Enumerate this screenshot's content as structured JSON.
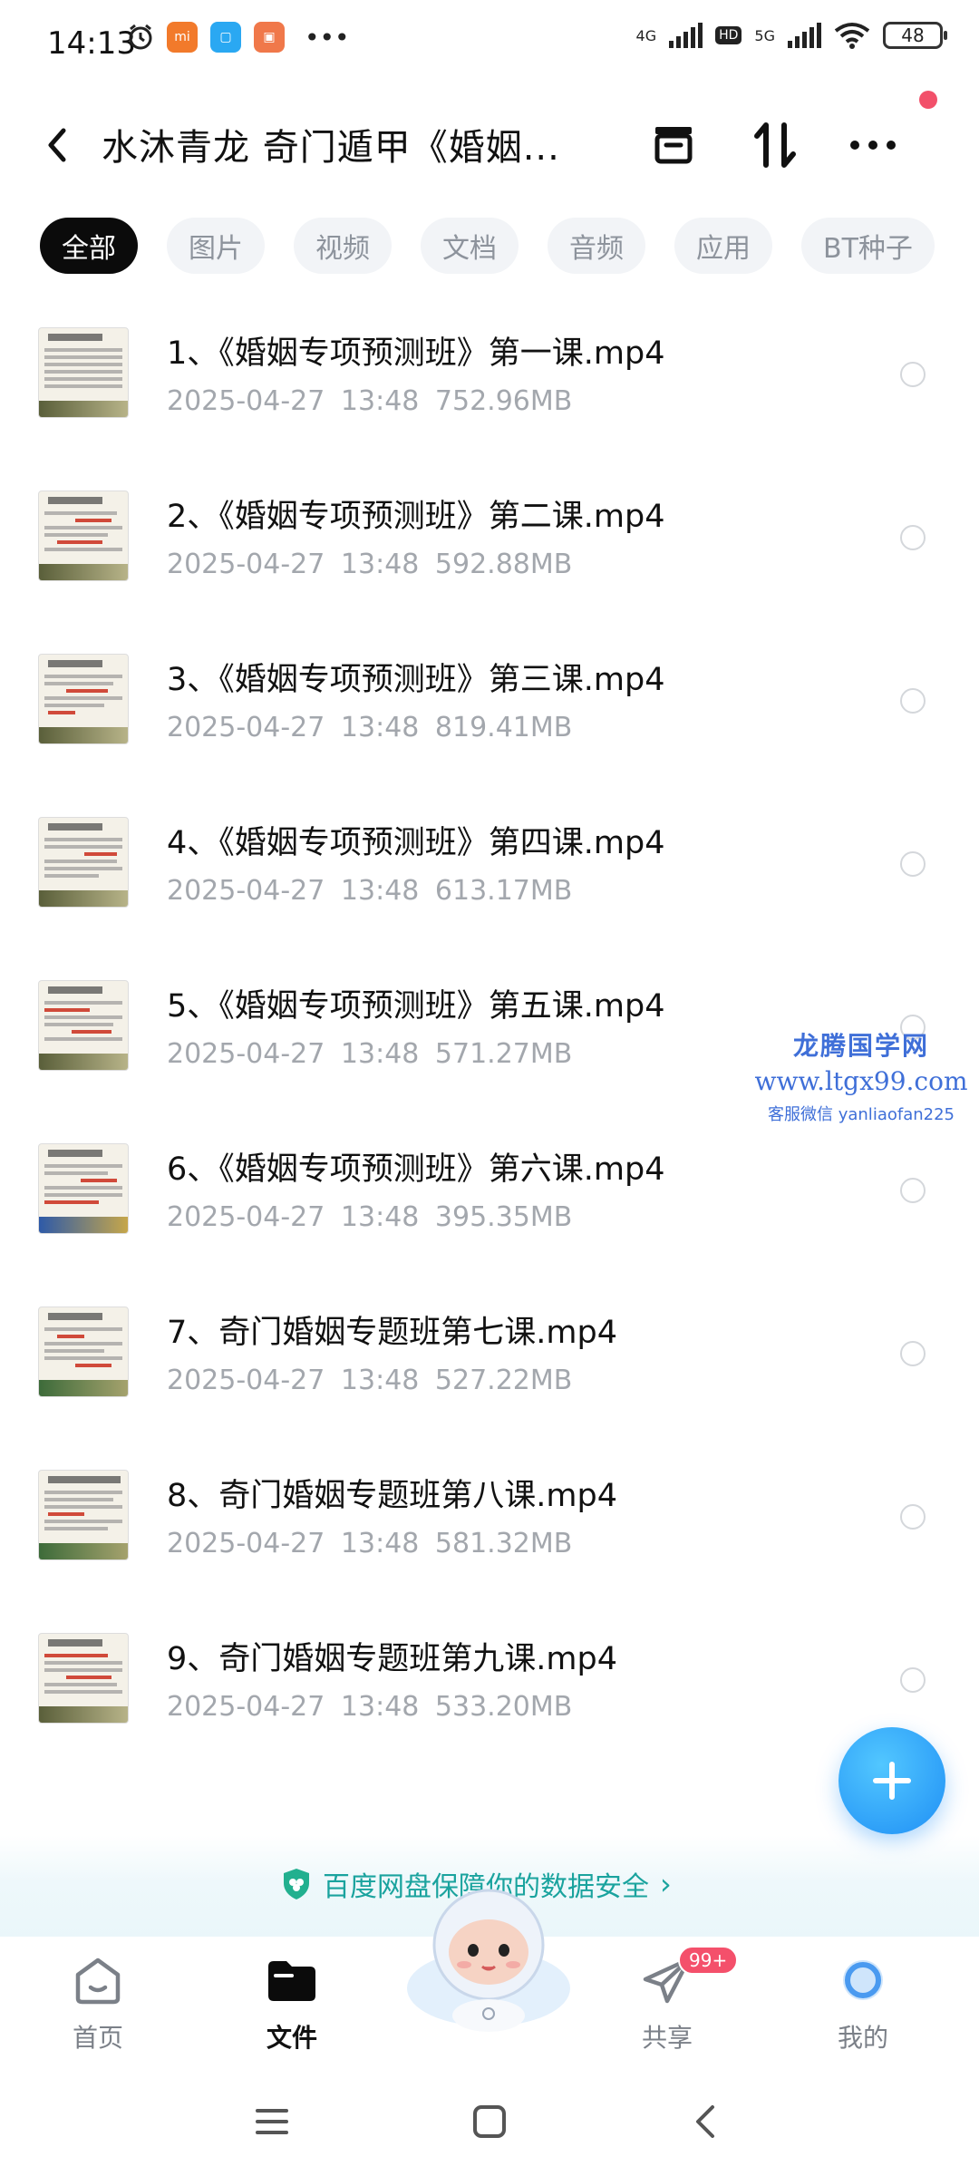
{
  "status_bar": {
    "time": "14:13",
    "network_4g": "4G",
    "hd": "HD",
    "network_5g": "5G",
    "battery": "48"
  },
  "header": {
    "title": "水沐青龙 奇门遁甲《婚姻..."
  },
  "tabs": [
    {
      "label": "全部",
      "active": true
    },
    {
      "label": "图片",
      "active": false
    },
    {
      "label": "视频",
      "active": false
    },
    {
      "label": "文档",
      "active": false
    },
    {
      "label": "音频",
      "active": false
    },
    {
      "label": "应用",
      "active": false
    },
    {
      "label": "BT种子",
      "active": false
    }
  ],
  "files": [
    {
      "name": "1、《婚姻专项预测班》第一课.mp4",
      "date": "2025-04-27",
      "time": "13:48",
      "size": "752.96MB"
    },
    {
      "name": "2、《婚姻专项预测班》第二课.mp4",
      "date": "2025-04-27",
      "time": "13:48",
      "size": "592.88MB"
    },
    {
      "name": "3、《婚姻专项预测班》第三课.mp4",
      "date": "2025-04-27",
      "time": "13:48",
      "size": "819.41MB"
    },
    {
      "name": "4、《婚姻专项预测班》第四课.mp4",
      "date": "2025-04-27",
      "time": "13:48",
      "size": "613.17MB"
    },
    {
      "name": "5、《婚姻专项预测班》第五课.mp4",
      "date": "2025-04-27",
      "time": "13:48",
      "size": "571.27MB"
    },
    {
      "name": "6、《婚姻专项预测班》第六课.mp4",
      "date": "2025-04-27",
      "time": "13:48",
      "size": "395.35MB"
    },
    {
      "name": "7、奇门婚姻专题班第七课.mp4",
      "date": "2025-04-27",
      "time": "13:48",
      "size": "527.22MB"
    },
    {
      "name": "8、奇门婚姻专题班第八课.mp4",
      "date": "2025-04-27",
      "time": "13:48",
      "size": "581.32MB"
    },
    {
      "name": "9、奇门婚姻专题班第九课.mp4",
      "date": "2025-04-27",
      "time": "13:48",
      "size": "533.20MB"
    }
  ],
  "watermark": {
    "line1": "龙腾国学网",
    "line2": "www.ltgx99.com",
    "line3": "客服微信 yanliaofan225"
  },
  "banner": {
    "text": "百度网盘保障你的数据安全"
  },
  "bottom_nav": {
    "home": "首页",
    "files": "文件",
    "share": "共享",
    "share_badge": "99+",
    "mine": "我的"
  },
  "colors": {
    "accent": "#1f8ff5",
    "banner_text": "#1aa39e",
    "badge": "#f4506b",
    "notify_dot": "#f2506a",
    "watermark": "#3f6fd8"
  },
  "icons": {
    "back": "back-arrow-icon",
    "archive": "archive-box-icon",
    "sort": "sort-arrows-icon",
    "more": "more-dots-icon",
    "add": "plus-icon",
    "shield": "shield-icon",
    "home": "home-icon",
    "folder": "folder-icon",
    "share": "paper-plane-icon",
    "mine": "profile-ring-icon"
  }
}
